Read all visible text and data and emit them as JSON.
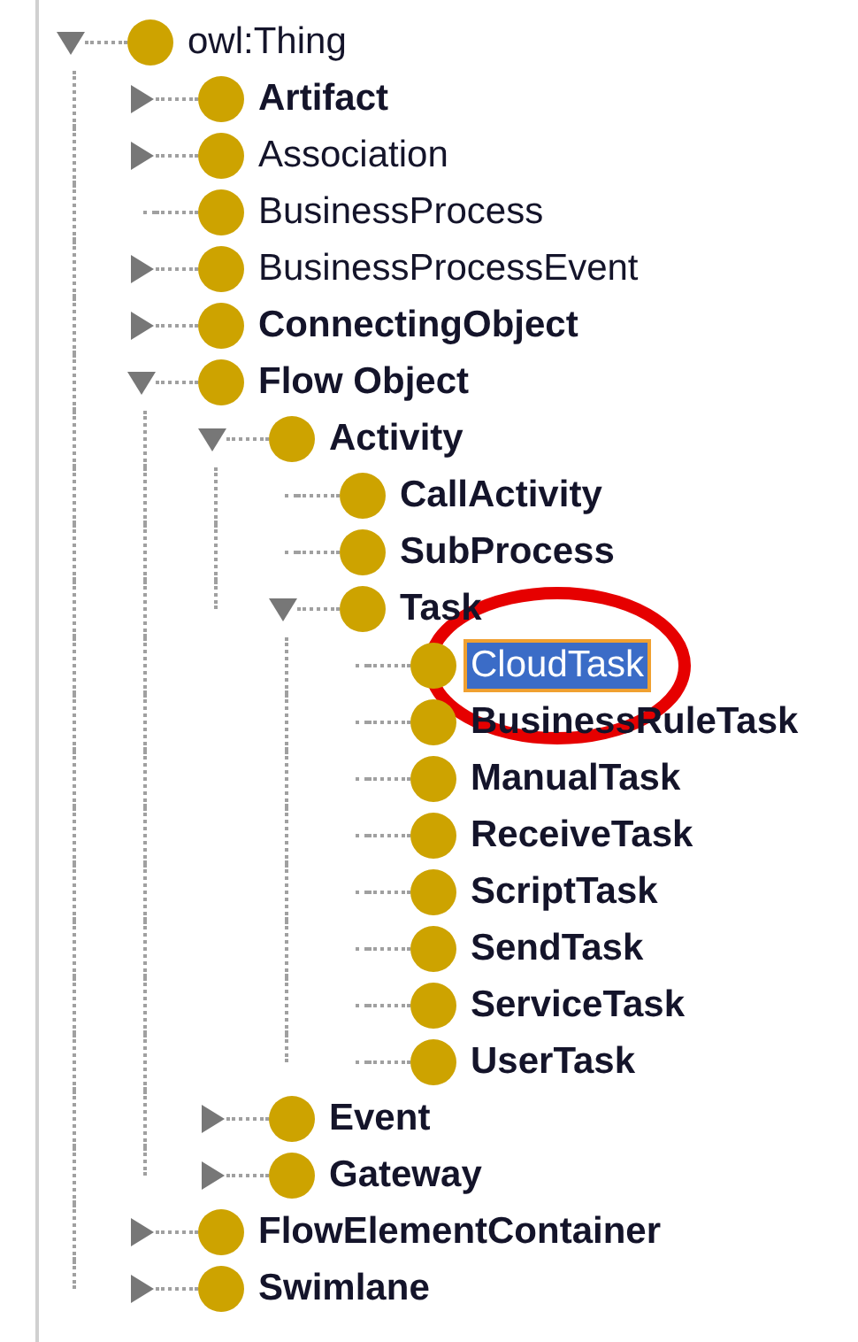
{
  "tree": [
    {
      "label": "owl:Thing",
      "bold": false,
      "selected": false,
      "expanded": true,
      "children": [
        {
          "label": "Artifact",
          "bold": true,
          "selected": false,
          "expanded": false
        },
        {
          "label": "Association",
          "bold": false,
          "selected": false,
          "expanded": false
        },
        {
          "label": "BusinessProcess",
          "bold": false,
          "selected": false
        },
        {
          "label": "BusinessProcessEvent",
          "bold": false,
          "selected": false,
          "expanded": false
        },
        {
          "label": "ConnectingObject",
          "bold": true,
          "selected": false,
          "expanded": false
        },
        {
          "label": "Flow Object",
          "bold": true,
          "selected": false,
          "expanded": true,
          "children": [
            {
              "label": "Activity",
              "bold": true,
              "selected": false,
              "expanded": true,
              "children": [
                {
                  "label": "CallActivity",
                  "bold": true,
                  "selected": false
                },
                {
                  "label": "SubProcess",
                  "bold": true,
                  "selected": false
                },
                {
                  "label": "Task",
                  "bold": true,
                  "selected": false,
                  "expanded": true,
                  "children": [
                    {
                      "label": "CloudTask",
                      "bold": false,
                      "selected": true
                    },
                    {
                      "label": "BusinessRuleTask",
                      "bold": true,
                      "selected": false
                    },
                    {
                      "label": "ManualTask",
                      "bold": true,
                      "selected": false
                    },
                    {
                      "label": "ReceiveTask",
                      "bold": true,
                      "selected": false
                    },
                    {
                      "label": "ScriptTask",
                      "bold": true,
                      "selected": false
                    },
                    {
                      "label": "SendTask",
                      "bold": true,
                      "selected": false
                    },
                    {
                      "label": "ServiceTask",
                      "bold": true,
                      "selected": false
                    },
                    {
                      "label": "UserTask",
                      "bold": true,
                      "selected": false
                    }
                  ]
                }
              ]
            },
            {
              "label": "Event",
              "bold": true,
              "selected": false,
              "expanded": false
            },
            {
              "label": "Gateway",
              "bold": true,
              "selected": false,
              "expanded": false
            }
          ]
        },
        {
          "label": "FlowElementContainer",
          "bold": true,
          "selected": false,
          "expanded": false
        },
        {
          "label": "Swimlane",
          "bold": true,
          "selected": false,
          "expanded": false
        }
      ]
    }
  ]
}
